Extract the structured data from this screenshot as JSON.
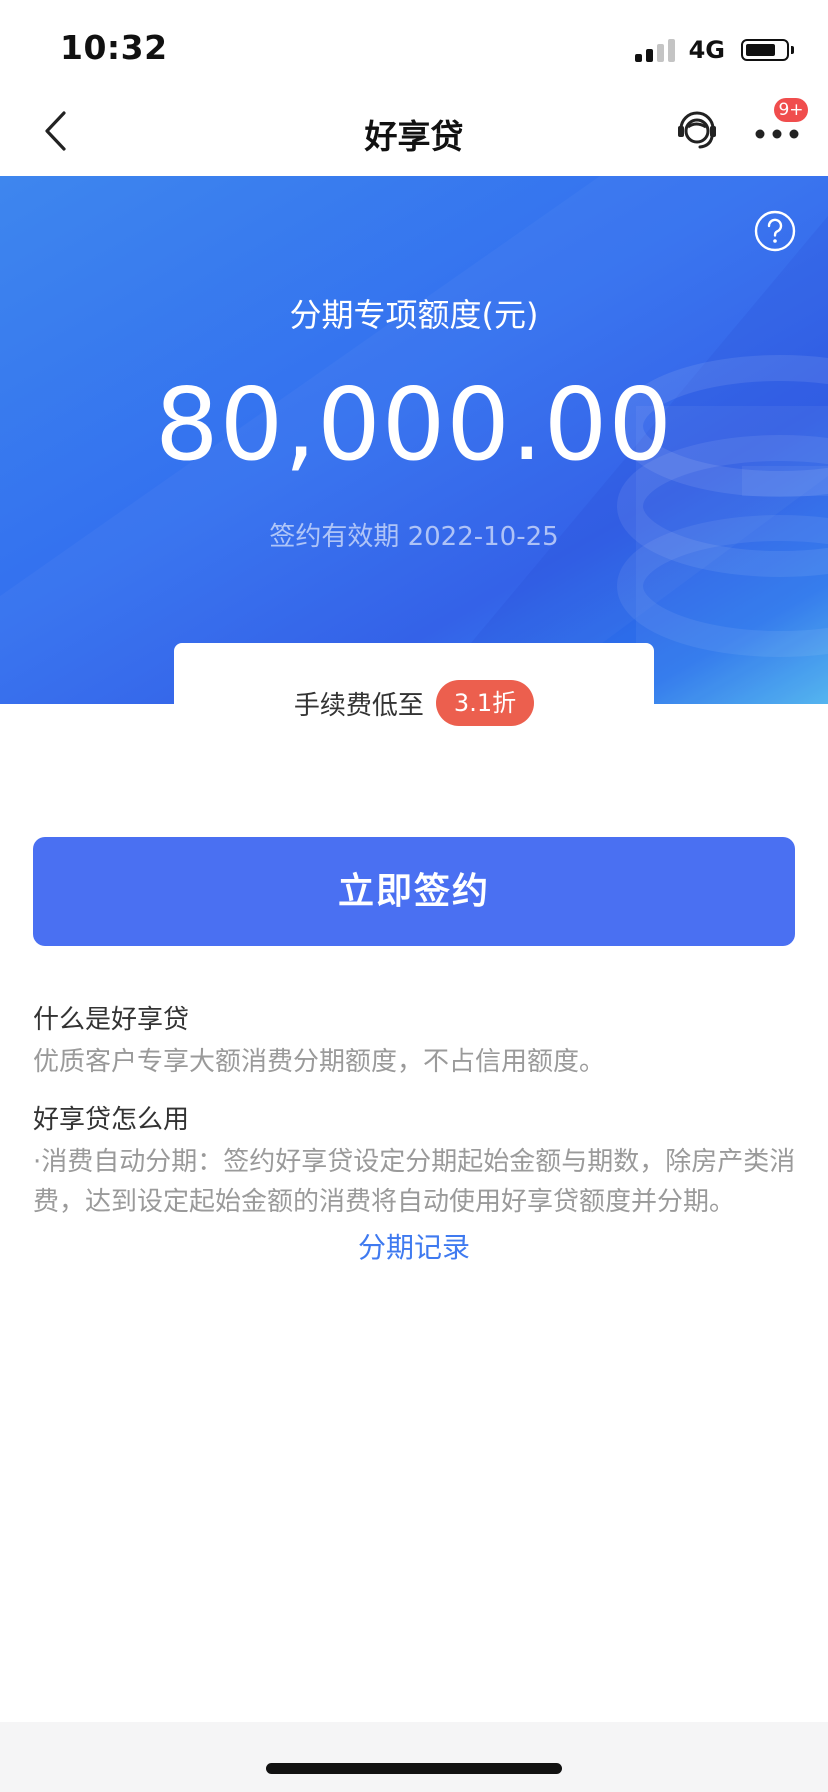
{
  "status_bar": {
    "time": "10:32",
    "network": "4G",
    "signal_bars_active": 2,
    "battery_level": 0.75
  },
  "nav": {
    "title": "好享贷",
    "badge": "9+",
    "icons": {
      "back": "chevron-left-icon",
      "service": "customer-service-icon",
      "more": "more-dots-icon"
    }
  },
  "hero": {
    "label": "分期专项额度(元)",
    "amount": "80,000.00",
    "validity": "签约有效期 2022-10-25",
    "help_icon": "help-icon"
  },
  "fee": {
    "label": "手续费低至",
    "tag": "3.1折"
  },
  "actions": {
    "sign_label": "立即签约"
  },
  "info": {
    "q1_title": "什么是好享贷",
    "q1_desc": "优质客户专享大额消费分期额度，不占信用额度。",
    "q2_title": "好享贷怎么用",
    "q2_desc": "·消费自动分期：签约好享贷设定分期起始金额与期数，除房产类消费，达到设定起始金额的消费将自动使用好享贷额度并分期。"
  },
  "links": {
    "records": "分期记录"
  },
  "colors": {
    "primary_button": "#4a70f2",
    "link": "#3f7af0",
    "badge": "#f04d4d",
    "fee_tag": "#ec5f4e",
    "hero_start": "#3e86ee",
    "hero_end": "#52c2f5"
  }
}
